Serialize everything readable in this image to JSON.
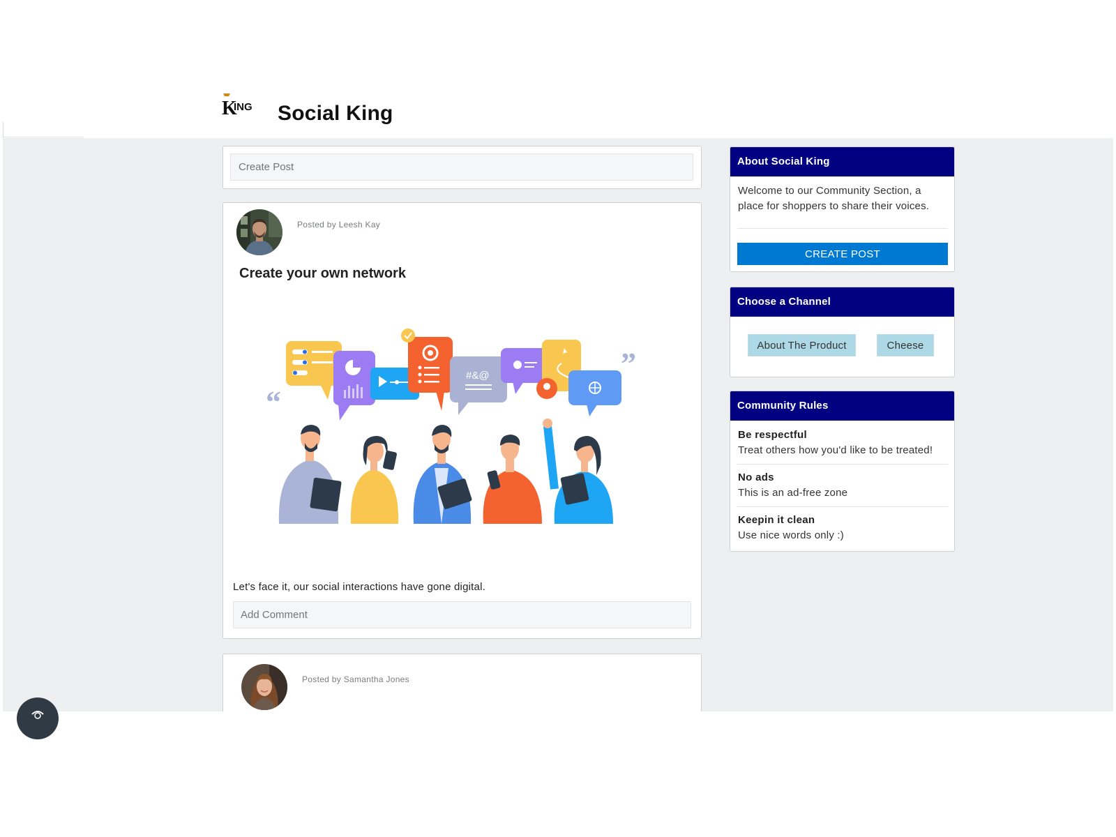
{
  "header": {
    "logo_text": "KING",
    "site_title": "Social King"
  },
  "composer": {
    "placeholder": "Create Post"
  },
  "posts": [
    {
      "posted_by": "Posted by Leesh Kay",
      "title": "Create your own network",
      "body": "Let's face it, our social interactions have gone digital.",
      "comment_placeholder": "Add Comment"
    },
    {
      "posted_by": "Posted by Samantha Jones"
    }
  ],
  "sidebar": {
    "about": {
      "title": "About Social King",
      "text": "Welcome to our Community Section, a place for shoppers to share their voices.",
      "button": "CREATE POST"
    },
    "channels": {
      "title": "Choose a Channel",
      "items": [
        "About The Product",
        "Cheese"
      ]
    },
    "rules": {
      "title": "Community Rules",
      "items": [
        {
          "title": "Be respectful",
          "desc": "Treat others how you'd like to be treated!"
        },
        {
          "title": "No ads",
          "desc": "This is an ad-free zone"
        },
        {
          "title": "Keepin it clean",
          "desc": "Use nice words only :)"
        }
      ]
    }
  },
  "colors": {
    "header_bar": "#000080",
    "primary_button": "#0079d3",
    "channel_button": "#add8e6",
    "page_background": "#edeff1"
  }
}
